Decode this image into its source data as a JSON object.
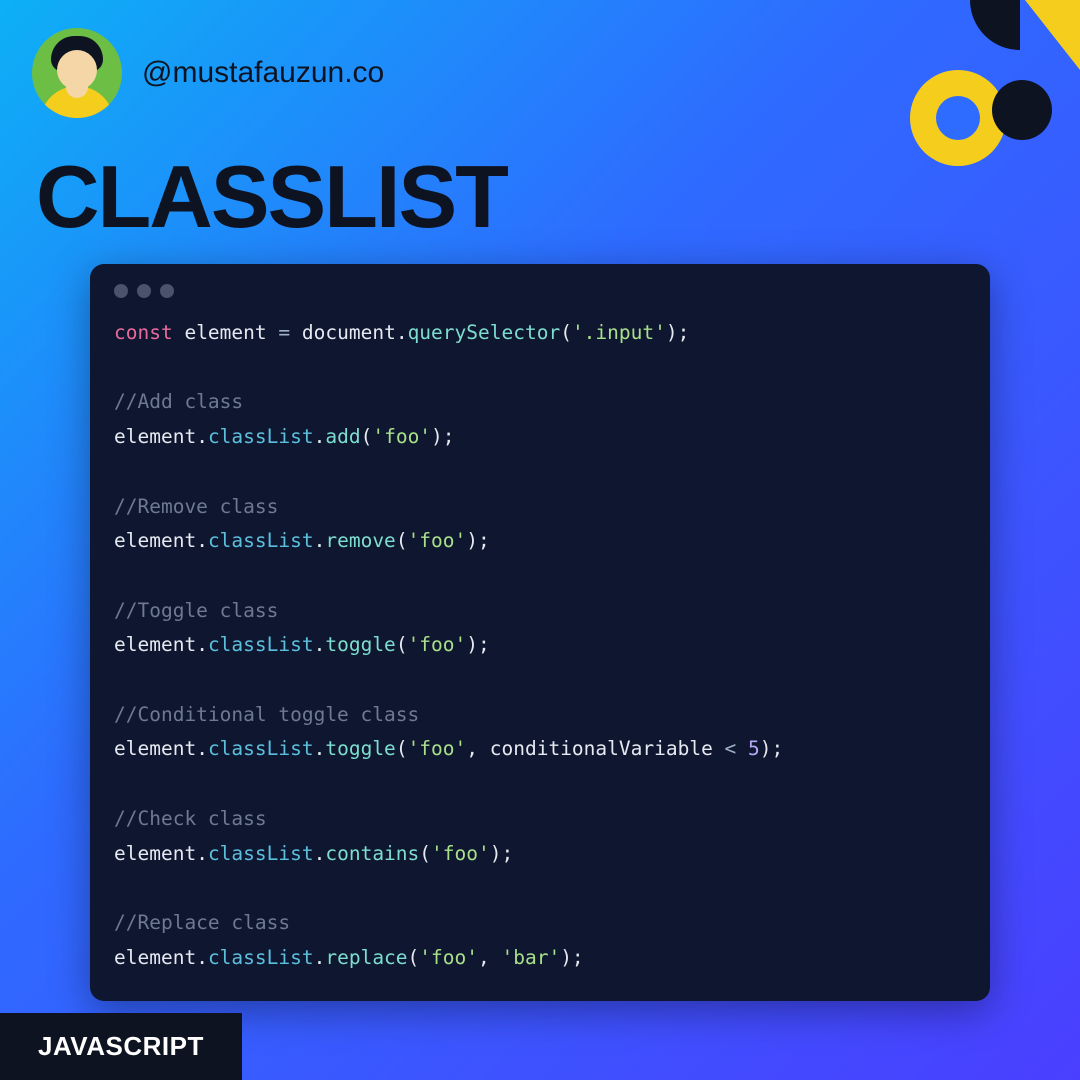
{
  "header": {
    "handle": "@mustafauzun.co"
  },
  "title": "CLASSLIST",
  "footer": {
    "label": "JAVASCRIPT"
  },
  "code": {
    "lines": [
      {
        "type": "decl",
        "keyword": "const",
        "ident": "element",
        "assign": "=",
        "obj": "document",
        "fn": "querySelector",
        "args": [
          {
            "t": "str",
            "v": "'.input'"
          }
        ]
      },
      {
        "type": "blank"
      },
      {
        "type": "comment",
        "text": "//Add class"
      },
      {
        "type": "call",
        "obj": "element",
        "prop": "classList",
        "fn": "add",
        "args": [
          {
            "t": "str",
            "v": "'foo'"
          }
        ]
      },
      {
        "type": "blank"
      },
      {
        "type": "comment",
        "text": "//Remove class"
      },
      {
        "type": "call",
        "obj": "element",
        "prop": "classList",
        "fn": "remove",
        "args": [
          {
            "t": "str",
            "v": "'foo'"
          }
        ]
      },
      {
        "type": "blank"
      },
      {
        "type": "comment",
        "text": "//Toggle class"
      },
      {
        "type": "call",
        "obj": "element",
        "prop": "classList",
        "fn": "toggle",
        "args": [
          {
            "t": "str",
            "v": "'foo'"
          }
        ]
      },
      {
        "type": "blank"
      },
      {
        "type": "comment",
        "text": "//Conditional toggle class"
      },
      {
        "type": "call",
        "obj": "element",
        "prop": "classList",
        "fn": "toggle",
        "args": [
          {
            "t": "str",
            "v": "'foo'"
          },
          {
            "t": "raw",
            "pieces": [
              {
                "t": "id",
                "v": "conditionalVariable"
              },
              {
                "t": "op",
                "v": " < "
              },
              {
                "t": "num",
                "v": "5"
              }
            ]
          }
        ]
      },
      {
        "type": "blank"
      },
      {
        "type": "comment",
        "text": "//Check class"
      },
      {
        "type": "call",
        "obj": "element",
        "prop": "classList",
        "fn": "contains",
        "args": [
          {
            "t": "str",
            "v": "'foo'"
          }
        ]
      },
      {
        "type": "blank"
      },
      {
        "type": "comment",
        "text": "//Replace class"
      },
      {
        "type": "call",
        "obj": "element",
        "prop": "classList",
        "fn": "replace",
        "args": [
          {
            "t": "str",
            "v": "'foo'"
          },
          {
            "t": "str",
            "v": "'bar'"
          }
        ]
      }
    ]
  }
}
